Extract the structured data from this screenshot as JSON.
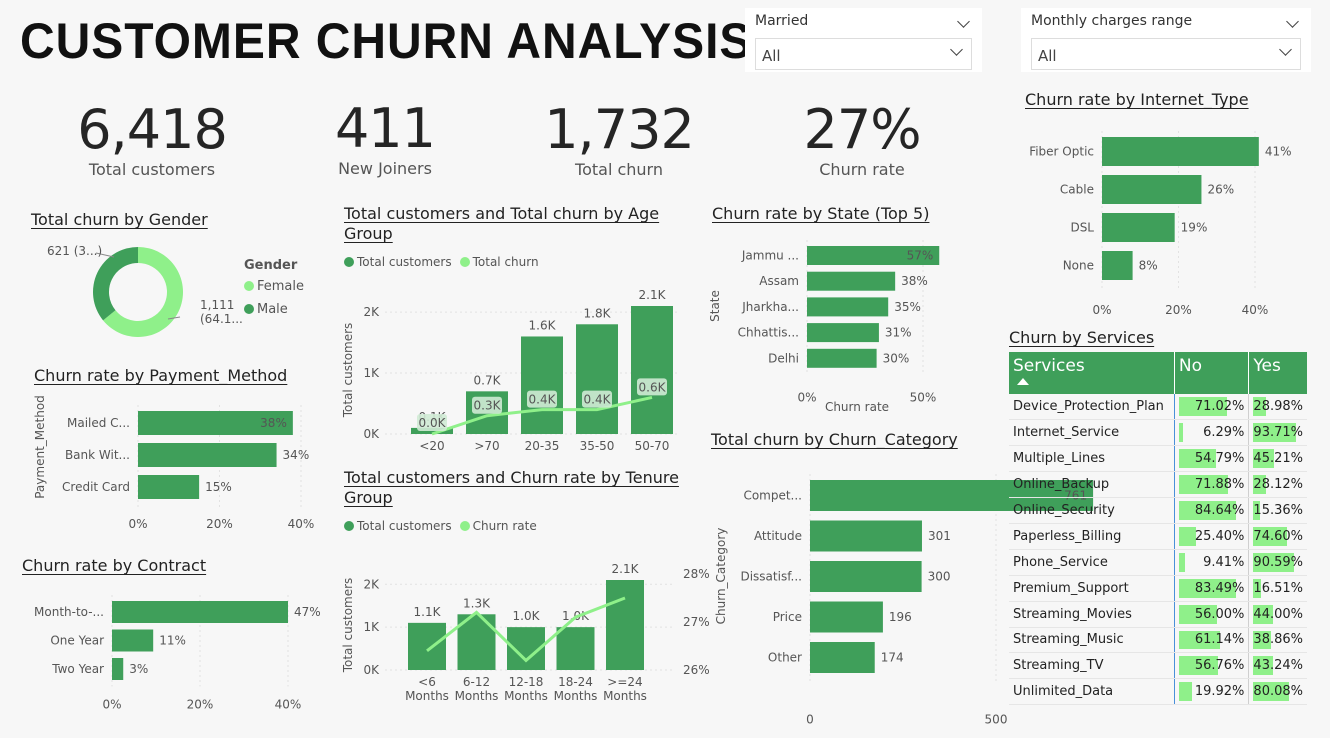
{
  "title": "CUSTOMER CHURN ANALYSIS",
  "slicers": [
    {
      "label": "Married",
      "value": "All"
    },
    {
      "label": "Monthly charges range",
      "value": "All"
    }
  ],
  "kpis": [
    {
      "value": "6,418",
      "caption": "Total customers"
    },
    {
      "value": "411",
      "caption": "New Joiners"
    },
    {
      "value": "1,732",
      "caption": "Total churn"
    },
    {
      "value": "27%",
      "caption": "Churn rate"
    }
  ],
  "colors": {
    "dark_green": "#3f9f5a",
    "light_green": "#8ff08a",
    "text": "#333333"
  },
  "chart_data": [
    {
      "id": "gender",
      "type": "pie",
      "title": "Total churn by Gender",
      "legend_title": "Gender",
      "slices": [
        {
          "name": "Female",
          "value": 1111,
          "label": "1,111\n(64.1...",
          "color": "#8ff08a"
        },
        {
          "name": "Male",
          "value": 621,
          "label": "621 (3...)",
          "color": "#3f9f5a"
        }
      ]
    },
    {
      "id": "payment",
      "type": "bar",
      "orientation": "horizontal",
      "title": "Churn rate by Payment_Method",
      "ylabel": "Payment_Method",
      "categories": [
        "Mailed C...",
        "Bank Wit...",
        "Credit Card"
      ],
      "values": [
        38,
        34,
        15
      ],
      "data_labels": [
        "38%",
        "34%",
        "15%"
      ],
      "xlim": [
        0,
        40
      ],
      "xticks": [
        "0%",
        "20%",
        "40%"
      ]
    },
    {
      "id": "contract",
      "type": "bar",
      "orientation": "horizontal",
      "title": "Churn rate by Contract",
      "categories": [
        "Month-to-...",
        "One Year",
        "Two Year"
      ],
      "values": [
        47,
        11,
        3
      ],
      "data_labels": [
        "47%",
        "11%",
        "3%"
      ],
      "xlim": [
        0,
        47
      ],
      "xticks": [
        "0%",
        "20%",
        "40%"
      ]
    },
    {
      "id": "age",
      "type": "bar",
      "title": "Total customers and Total churn by Age Group",
      "ylabel": "Total customers",
      "legend": [
        "Total customers",
        "Total churn"
      ],
      "categories": [
        "<20",
        ">70",
        "20-35",
        "35-50",
        "50-70"
      ],
      "series": [
        {
          "name": "Total customers",
          "values": [
            100,
            700,
            1600,
            1800,
            2100
          ],
          "labels": [
            "0.1K",
            "0.7K",
            "1.6K",
            "1.8K",
            "2.1K"
          ]
        },
        {
          "name": "Total churn",
          "values": [
            0,
            300,
            400,
            400,
            600
          ],
          "labels": [
            "0.0K",
            "0.3K",
            "0.4K",
            "0.4K",
            "0.6K"
          ]
        }
      ],
      "ylim": [
        0,
        2100
      ],
      "yticks": [
        "0K",
        "1K",
        "2K"
      ]
    },
    {
      "id": "tenure",
      "type": "bar",
      "title": "Total customers and Churn rate by Tenure Group",
      "ylabel": "Total customers",
      "legend": [
        "Total customers",
        "Churn rate"
      ],
      "categories": [
        "<6\nMonths",
        "6-12\nMonths",
        "12-18\nMonths",
        "18-24\nMonths",
        ">=24\nMonths"
      ],
      "series": [
        {
          "name": "Total customers",
          "values": [
            1100,
            1300,
            1000,
            1000,
            2100
          ],
          "labels": [
            "1.1K",
            "1.3K",
            "1.0K",
            "1.0K",
            "2.1K"
          ]
        },
        {
          "name": "Churn rate",
          "values": [
            26.4,
            27.2,
            26.2,
            27.1,
            27.5
          ],
          "labels": []
        }
      ],
      "ylim": [
        0,
        2100
      ],
      "yticks": [
        "0K",
        "1K",
        "2K"
      ],
      "y2lim": [
        26,
        28
      ],
      "y2ticks": [
        "26%",
        "27%",
        "28%"
      ]
    },
    {
      "id": "state",
      "type": "bar",
      "orientation": "horizontal",
      "title": "Churn rate by State (Top 5)",
      "xlabel": "Churn rate",
      "ylabel": "State",
      "categories": [
        "Jammu ...",
        "Assam",
        "Jharkha...",
        "Chhattis...",
        "Delhi"
      ],
      "values": [
        57,
        38,
        35,
        31,
        30
      ],
      "data_labels": [
        "57%",
        "38%",
        "35%",
        "31%",
        "30%"
      ],
      "xlim": [
        0,
        50
      ],
      "xticks": [
        "0%",
        "50%"
      ]
    },
    {
      "id": "category",
      "type": "bar",
      "orientation": "horizontal",
      "title": "Total churn by Churn_Category",
      "ylabel": "Churn_Category",
      "categories": [
        "Compet...",
        "Attitude",
        "Dissatisf...",
        "Price",
        "Other"
      ],
      "values": [
        761,
        301,
        300,
        196,
        174
      ],
      "data_labels": [
        "761",
        "301",
        "300",
        "196",
        "174"
      ],
      "xlim": [
        0,
        500
      ],
      "xticks": [
        "0",
        "500"
      ]
    },
    {
      "id": "internet",
      "type": "bar",
      "orientation": "horizontal",
      "title": "Churn rate by Internet_Type",
      "categories": [
        "Fiber Optic",
        "Cable",
        "DSL",
        "None"
      ],
      "values": [
        41,
        26,
        19,
        8
      ],
      "data_labels": [
        "41%",
        "26%",
        "19%",
        "8%"
      ],
      "xlim": [
        0,
        40
      ],
      "xticks": [
        "0%",
        "20%",
        "40%"
      ]
    },
    {
      "id": "services",
      "type": "table",
      "title": "Churn by Services",
      "columns": [
        "Services",
        "No",
        "Yes"
      ],
      "rows": [
        [
          "Device_Protection_Plan",
          71.02,
          28.98
        ],
        [
          "Internet_Service",
          6.29,
          93.71
        ],
        [
          "Multiple_Lines",
          54.79,
          45.21
        ],
        [
          "Online_Backup",
          71.88,
          28.12
        ],
        [
          "Online_Security",
          84.64,
          15.36
        ],
        [
          "Paperless_Billing",
          25.4,
          74.6
        ],
        [
          "Phone_Service",
          9.41,
          90.59
        ],
        [
          "Premium_Support",
          83.49,
          16.51
        ],
        [
          "Streaming_Movies",
          56.0,
          44.0
        ],
        [
          "Streaming_Music",
          61.14,
          38.86
        ],
        [
          "Streaming_TV",
          56.76,
          43.24
        ],
        [
          "Unlimited_Data",
          19.92,
          80.08
        ]
      ]
    }
  ]
}
